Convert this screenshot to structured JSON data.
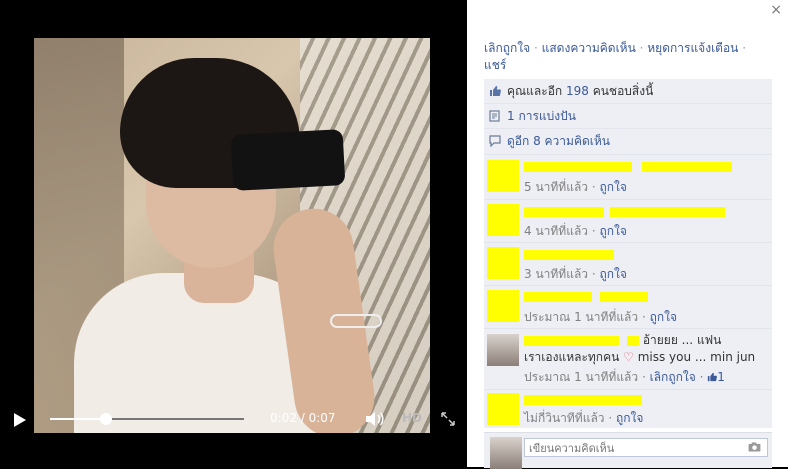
{
  "player": {
    "time_label": "0:02 / 0:07",
    "progress_fraction": 0.29,
    "hd_label": "HD"
  },
  "panel": {
    "close_glyph": "×",
    "actions": {
      "unlike": "เลิกถูกใจ",
      "comment": "แสดงความคิดเห็น",
      "stop_notify": "หยุดการแจ้งเตือน",
      "share": "แชร์"
    },
    "likes": {
      "prefix": "คุณและอีก ",
      "count": "198",
      "suffix": " คนชอบสิ่งนี้"
    },
    "shares": "1 การแบ่งปัน",
    "more_comments": "ดูอีก 8 ความคิดเห็น",
    "comments": [
      {
        "time": "5 นาทีที่แล้ว",
        "action": "ถูกใจ"
      },
      {
        "time": "4 นาทีที่แล้ว",
        "action": "ถูกใจ"
      },
      {
        "time": "3 นาทีที่แล้ว",
        "action": "ถูกใจ"
      },
      {
        "time": "ประมาณ 1 นาทีที่แล้ว",
        "action": "ถูกใจ"
      },
      {
        "text1": "อ้ายยย ... แฟน",
        "text2a": "เราเองแหละทุกคน ",
        "heart": "♡",
        "text2b": " miss you ... min jun",
        "time": "ประมาณ 1 นาทีที่แล้ว",
        "action": "เลิกถูกใจ",
        "like_count": "1"
      },
      {
        "time": "ไม่กี่วินาทีที่แล้ว",
        "action": "ถูกใจ"
      }
    ],
    "composer_placeholder": "เขียนความคิดเห็น"
  },
  "colors": {
    "link": "#3b5998",
    "highlight": "#ffff00",
    "panel_row_bg": "#edeff4"
  }
}
